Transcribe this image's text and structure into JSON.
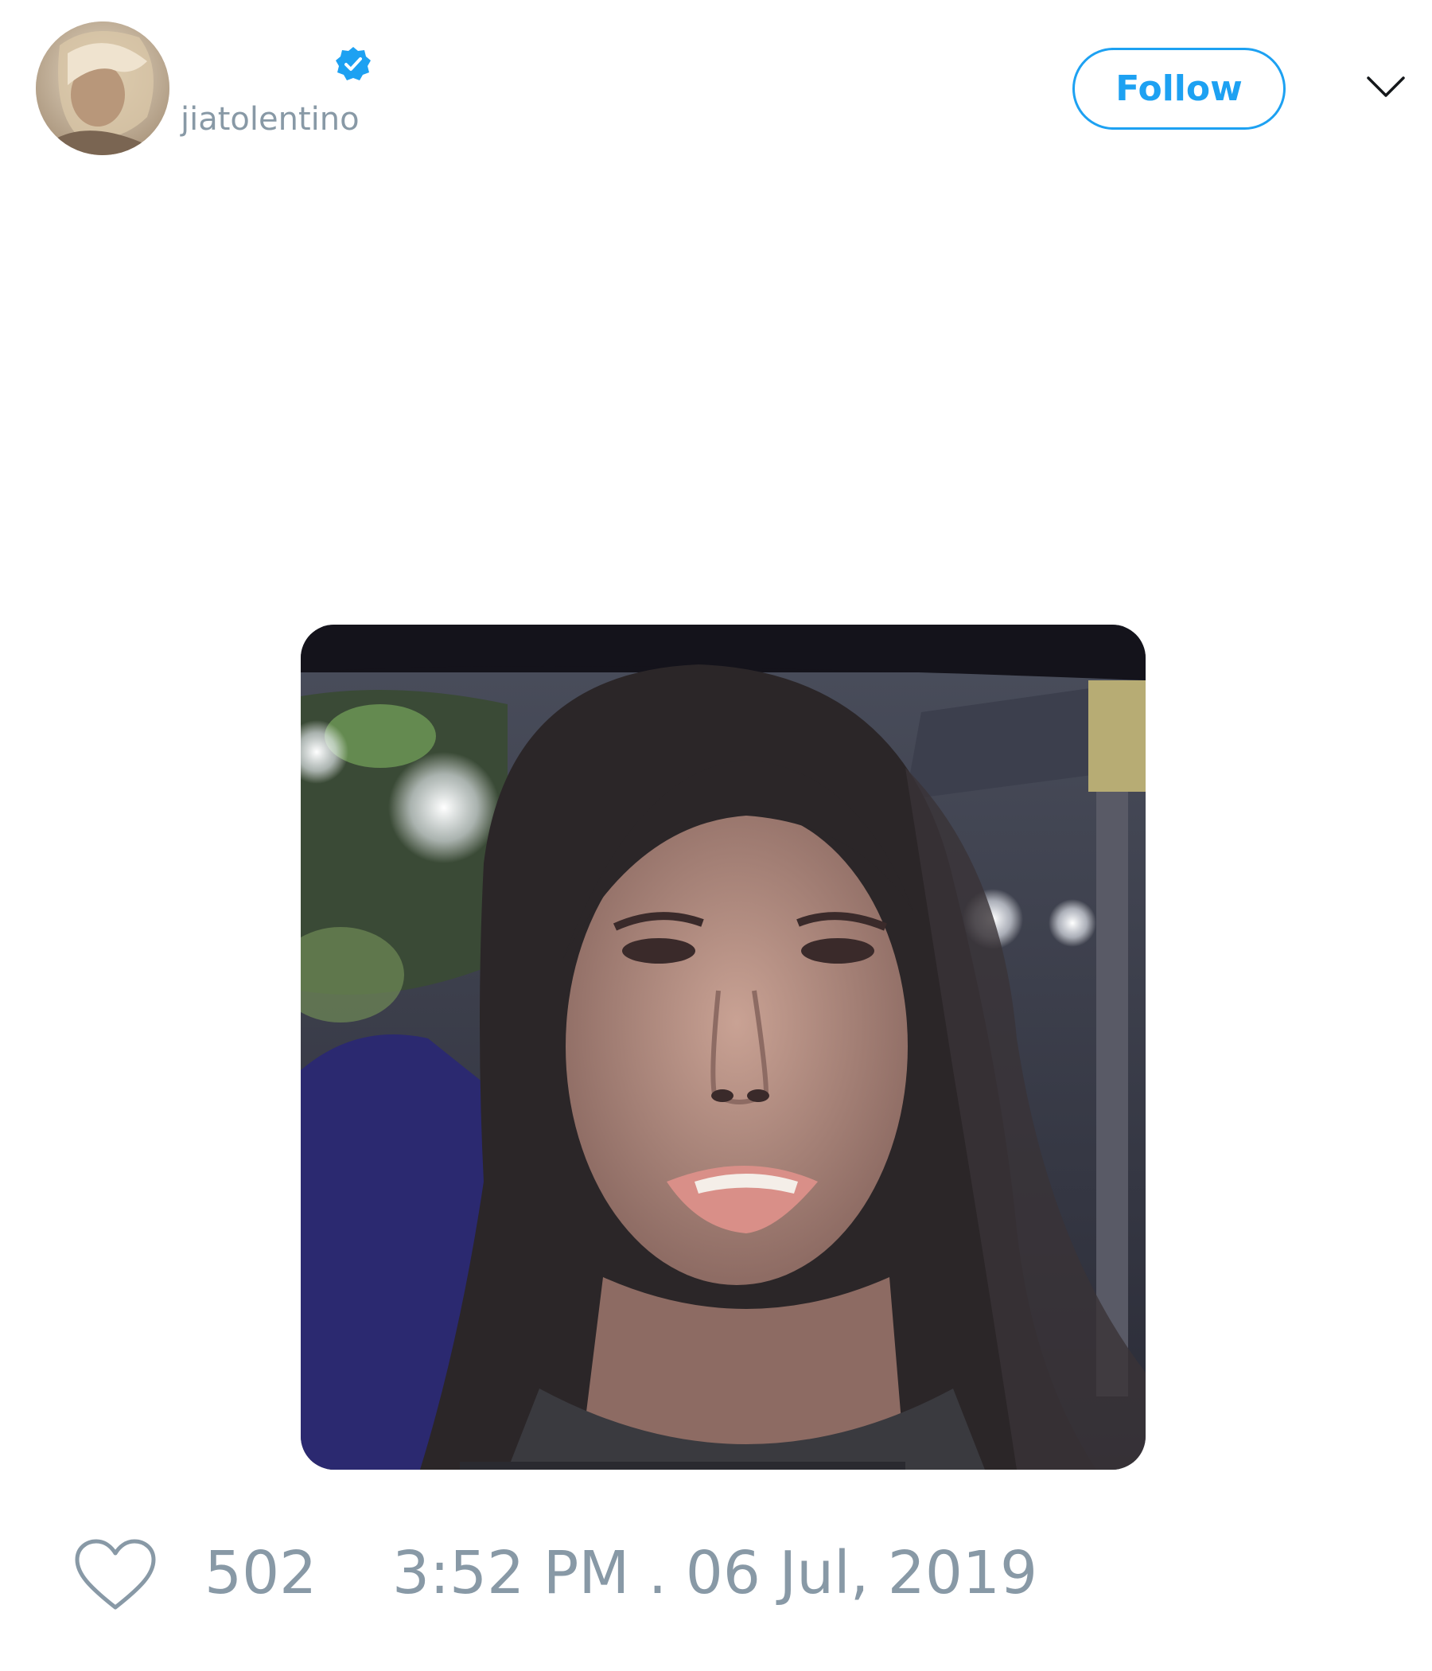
{
  "author": {
    "handle": "jiatolentino",
    "verified": true,
    "avatar_icon": "user-photo-avatar"
  },
  "actions": {
    "follow_label": "Follow",
    "menu_icon": "chevron-down-icon"
  },
  "media": {
    "type": "video-still"
  },
  "footer": {
    "like_icon": "heart-icon",
    "like_count": "502",
    "timestamp": "3:52 PM . 06 Jul, 2019"
  },
  "colors": {
    "accent": "#1da1f2",
    "muted_text": "#8899a6",
    "background": "#ffffff"
  }
}
